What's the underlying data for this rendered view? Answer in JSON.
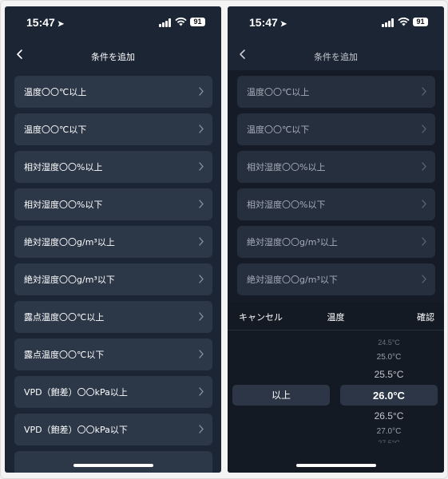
{
  "status": {
    "time": "15:47",
    "battery": "91"
  },
  "nav": {
    "title": "条件を追加"
  },
  "conditions": [
    "温度〇〇℃以上",
    "温度〇〇℃以下",
    "相対湿度〇〇%以上",
    "相対湿度〇〇%以下",
    "絶対湿度〇〇g/m³以上",
    "絶対湿度〇〇g/m³以下",
    "露点温度〇〇℃以上",
    "露点温度〇〇℃以下",
    "VPD（飽差）〇〇kPa以上",
    "VPD（飽差）〇〇kPa以下"
  ],
  "sheet": {
    "cancel": "キャンセル",
    "title": "温度",
    "confirm": "確認",
    "direction_selected": "以上",
    "values": [
      "24.5°C",
      "25.0°C",
      "25.5°C",
      "26.0°C",
      "26.5°C",
      "27.0°C",
      "27.5°C"
    ],
    "selected_value": "26.0°C"
  },
  "colors": {
    "background": "#1c2533",
    "card": "#2c3748",
    "sheet": "#141a24",
    "text": "#ffffff"
  }
}
